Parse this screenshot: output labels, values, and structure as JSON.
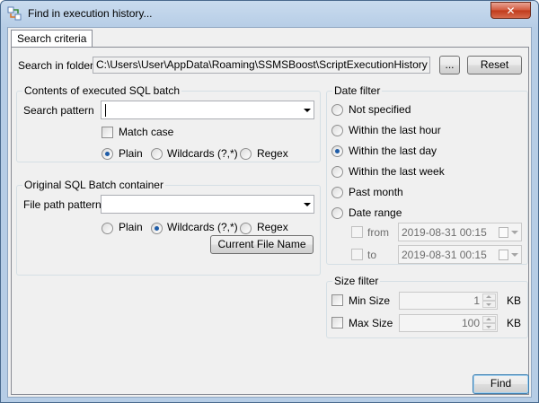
{
  "window": {
    "title": "Find in execution history...",
    "close_glyph": "✕"
  },
  "tabs": [
    {
      "label": "Search criteria",
      "active": true
    }
  ],
  "search_folder": {
    "label": "Search in folder",
    "value": "C:\\Users\\User\\AppData\\Roaming\\SSMSBoost\\ScriptExecutionHistory",
    "browse_label": "...",
    "reset_label": "Reset"
  },
  "contents_group": {
    "title": "Contents of executed SQL batch",
    "pattern_label": "Search pattern",
    "pattern_value": "",
    "match_case_label": "Match case",
    "match_case_checked": false,
    "mode_options": [
      "Plain",
      "Wildcards (?,*)",
      "Regex"
    ],
    "mode_selected": "Plain"
  },
  "container_group": {
    "title": "Original SQL Batch container",
    "file_pattern_label": "File path pattern",
    "file_pattern_value": "",
    "mode_options": [
      "Plain",
      "Wildcards (?,*)",
      "Regex"
    ],
    "mode_selected": "Wildcards (?,*)",
    "current_file_button": "Current File Name"
  },
  "date_filter": {
    "title": "Date filter",
    "options": [
      "Not specified",
      "Within the last hour",
      "Within the last day",
      "Within the last week",
      "Past month",
      "Date range"
    ],
    "selected": "Within the last day",
    "from_label": "from",
    "from_value": "2019-08-31 00:15",
    "to_label": "to",
    "to_value": "2019-08-31 00:15"
  },
  "size_filter": {
    "title": "Size filter",
    "min_label": "Min Size",
    "min_value": "1",
    "max_label": "Max Size",
    "max_value": "100",
    "unit": "KB"
  },
  "find_button": "Find",
  "colors": {
    "title_bg": "#b6cde6",
    "close_btn": "#c0391a",
    "radio_dot": "#1e5ca8"
  }
}
